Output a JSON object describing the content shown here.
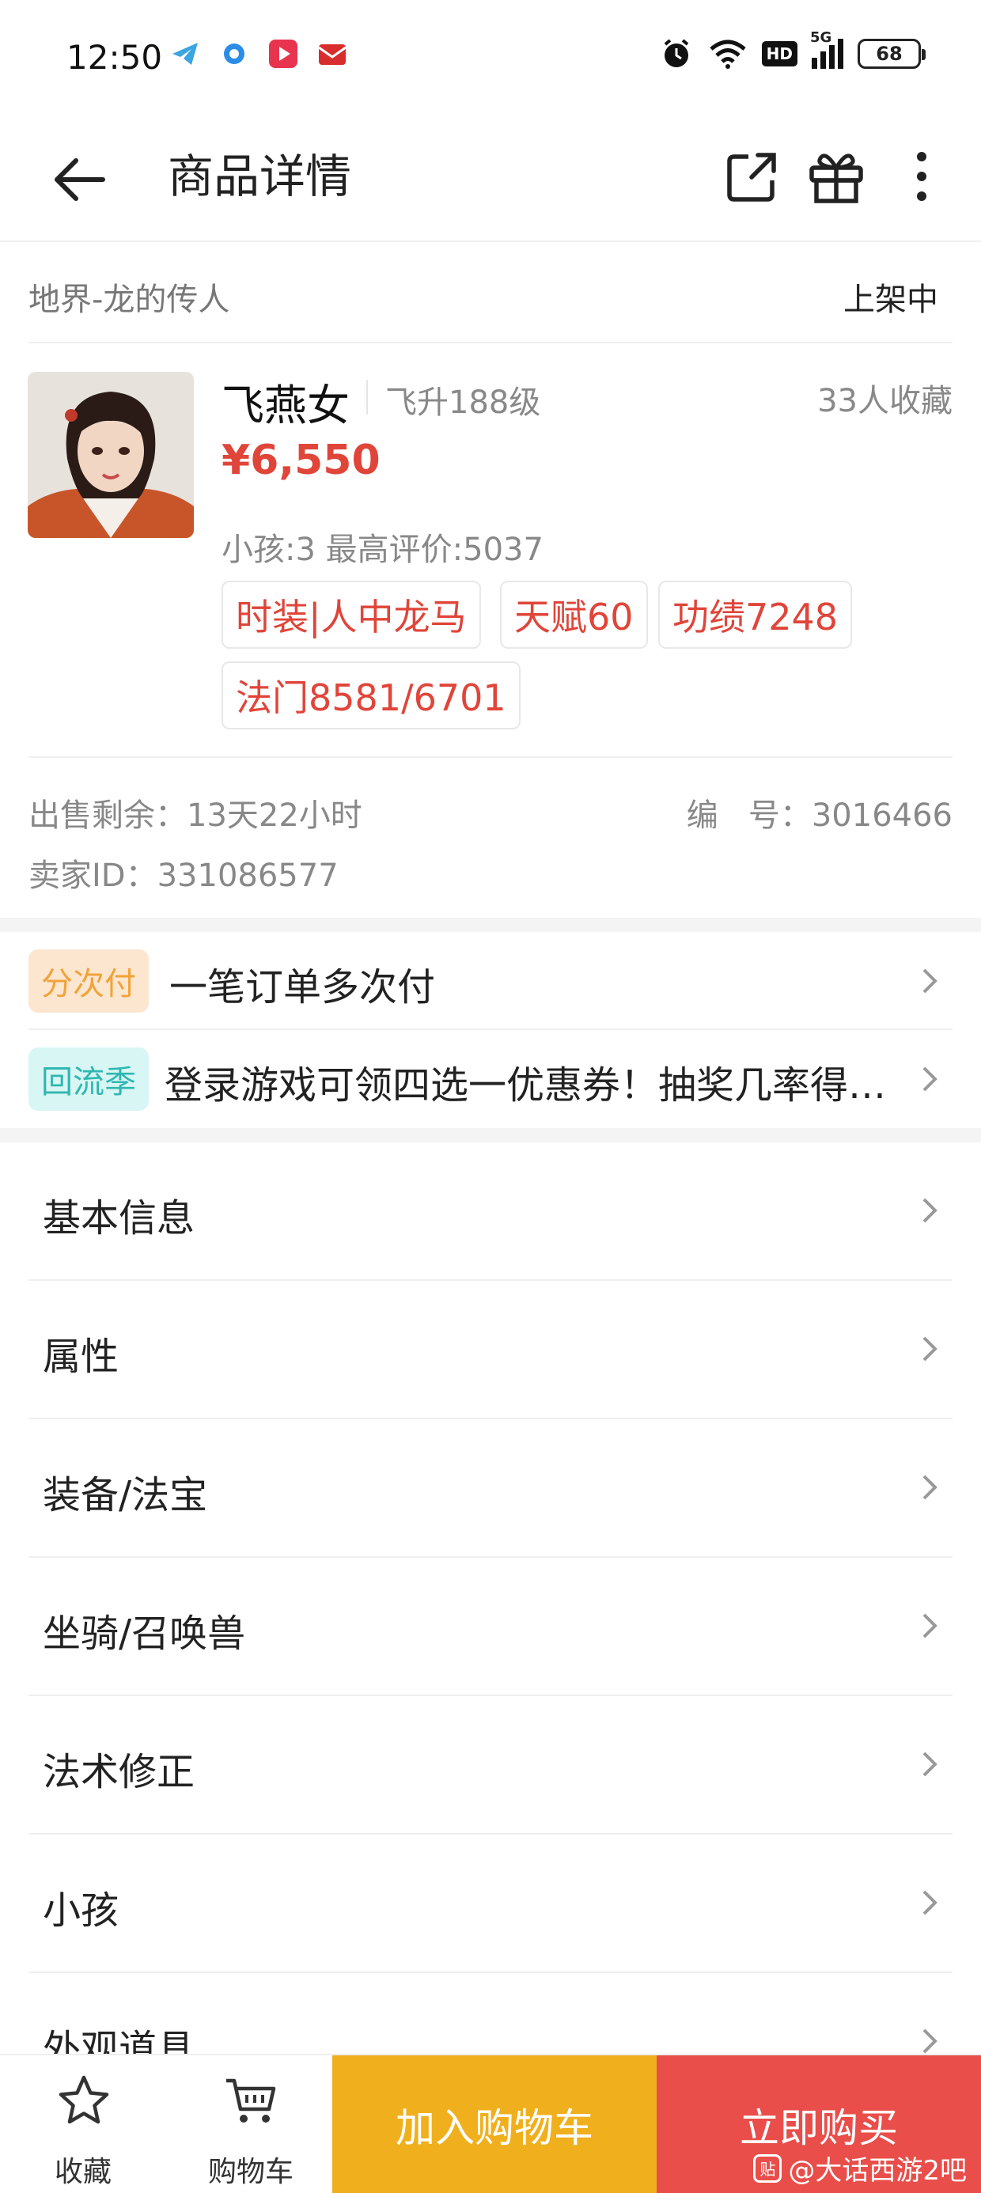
{
  "status_bar": {
    "time": "12:50",
    "hd_label": "HD",
    "network_label": "5G",
    "battery": "68",
    "icons": [
      "telegram-icon",
      "browser-icon",
      "video-app-icon",
      "mail-app-icon",
      "alarm-icon",
      "wifi-icon",
      "signal-icon"
    ]
  },
  "nav": {
    "title": "商品详情",
    "icons": [
      "back-arrow-icon",
      "share-icon",
      "gift-icon",
      "more-vertical-icon"
    ]
  },
  "product": {
    "server": "地界-龙的传人",
    "listing_status": "上架中",
    "name": "飞燕女",
    "level": "飞升188级",
    "favorites": "33人收藏",
    "price": "¥6,550",
    "meta": "小孩:3 最高评价:5037",
    "tags": [
      "时装|人中龙马",
      "天赋60",
      "功绩7248",
      "法门8581/6701"
    ],
    "time_left": "出售剩余：13天22小时",
    "item_id": "编   号：3016466",
    "seller_id": "卖家ID：331086577"
  },
  "promos": [
    {
      "badge": "分次付",
      "text": "一笔订单多次付",
      "badge_bg": "#fde6cf",
      "badge_color": "#f0a33a"
    },
    {
      "badge": "回流季",
      "text": "登录游戏可领四选一优惠券！抽奖几率得…",
      "badge_bg": "#d8f6f4",
      "badge_color": "#2fb7b0"
    }
  ],
  "sections": [
    "基本信息",
    "属性",
    "装备/法宝",
    "坐骑/召唤兽",
    "法术修正",
    "小孩",
    "外观道具"
  ],
  "bottom_bar": {
    "favorite_label": "收藏",
    "cart_label": "购物车",
    "add_to_cart": "加入购物车",
    "buy_now": "立即购买"
  },
  "watermark": {
    "icon_text": "贴",
    "text": "@大话西游2吧"
  },
  "colors": {
    "accent_red": "#e0453a",
    "add_cart_yellow": "#f0b01d",
    "buy_red": "#e94e4a"
  }
}
